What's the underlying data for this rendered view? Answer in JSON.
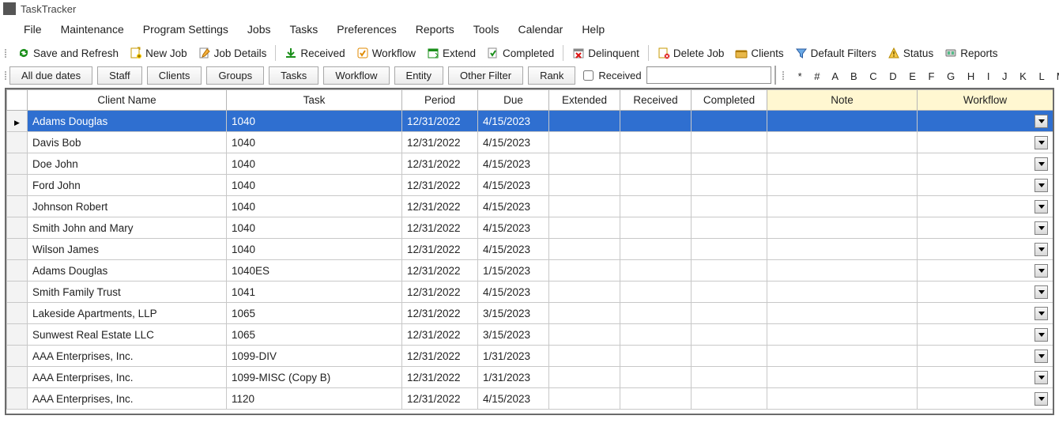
{
  "title": "TaskTracker",
  "menu": [
    "File",
    "Maintenance",
    "Program Settings",
    "Jobs",
    "Tasks",
    "Preferences",
    "Reports",
    "Tools",
    "Calendar",
    "Help"
  ],
  "toolbar": [
    {
      "id": "save-refresh",
      "label": "Save and Refresh"
    },
    {
      "id": "new-job",
      "label": "New Job"
    },
    {
      "id": "job-details",
      "label": "Job Details"
    },
    {
      "id": "received",
      "label": "Received"
    },
    {
      "id": "workflow",
      "label": "Workflow"
    },
    {
      "id": "extend",
      "label": "Extend"
    },
    {
      "id": "completed",
      "label": "Completed"
    },
    {
      "id": "delinquent",
      "label": "Delinquent"
    },
    {
      "id": "delete-job",
      "label": "Delete Job"
    },
    {
      "id": "clients",
      "label": "Clients"
    },
    {
      "id": "default-filters",
      "label": "Default Filters"
    },
    {
      "id": "status",
      "label": "Status"
    },
    {
      "id": "reports",
      "label": "Reports"
    }
  ],
  "filters": {
    "due": "All due dates",
    "buttons": [
      "Staff",
      "Clients",
      "Groups",
      "Tasks",
      "Workflow",
      "Entity",
      "Other Filter",
      "Rank"
    ],
    "received_label": "Received",
    "received_checked": false,
    "search_value": "",
    "alpha": "* # A B C D E F G H I J K L M"
  },
  "columns": [
    "",
    "Client Name",
    "Task",
    "Period",
    "Due",
    "Extended",
    "Received",
    "Completed",
    "Note",
    "Workflow",
    ""
  ],
  "rows": [
    {
      "client": "Adams Douglas",
      "task": "1040",
      "period": "12/31/2022",
      "due": "4/15/2023",
      "selected": true
    },
    {
      "client": "Davis Bob",
      "task": "1040",
      "period": "12/31/2022",
      "due": "4/15/2023"
    },
    {
      "client": "Doe John",
      "task": "1040",
      "period": "12/31/2022",
      "due": "4/15/2023"
    },
    {
      "client": "Ford John",
      "task": "1040",
      "period": "12/31/2022",
      "due": "4/15/2023"
    },
    {
      "client": "Johnson Robert",
      "task": "1040",
      "period": "12/31/2022",
      "due": "4/15/2023"
    },
    {
      "client": "Smith John and Mary",
      "task": "1040",
      "period": "12/31/2022",
      "due": "4/15/2023"
    },
    {
      "client": "Wilson James",
      "task": "1040",
      "period": "12/31/2022",
      "due": "4/15/2023"
    },
    {
      "client": "Adams Douglas",
      "task": "1040ES",
      "period": "12/31/2022",
      "due": "1/15/2023"
    },
    {
      "client": "Smith Family Trust",
      "task": "1041",
      "period": "12/31/2022",
      "due": "4/15/2023"
    },
    {
      "client": "Lakeside Apartments, LLP",
      "task": "1065",
      "period": "12/31/2022",
      "due": "3/15/2023"
    },
    {
      "client": "Sunwest Real Estate LLC",
      "task": "1065",
      "period": "12/31/2022",
      "due": "3/15/2023"
    },
    {
      "client": "AAA Enterprises, Inc.",
      "task": "1099-DIV",
      "period": "12/31/2022",
      "due": "1/31/2023"
    },
    {
      "client": "AAA Enterprises, Inc.",
      "task": "1099-MISC (Copy B)",
      "period": "12/31/2022",
      "due": "1/31/2023"
    },
    {
      "client": "AAA Enterprises, Inc.",
      "task": "1120",
      "period": "12/31/2022",
      "due": "4/15/2023"
    }
  ]
}
